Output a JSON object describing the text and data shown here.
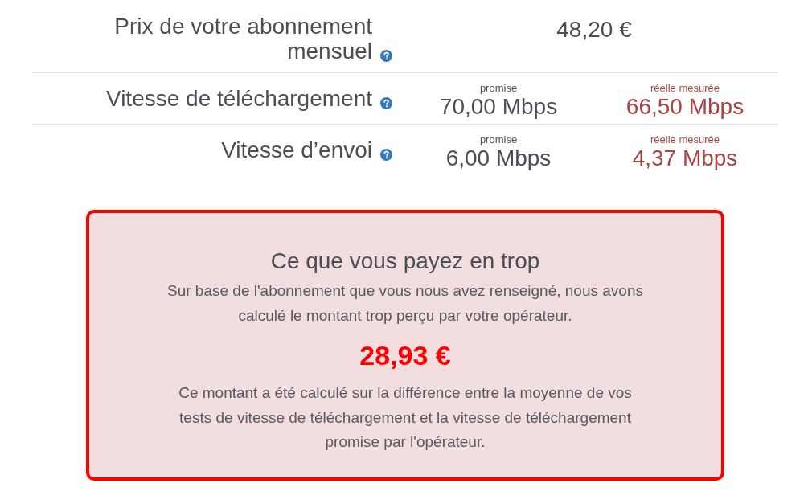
{
  "rows": [
    {
      "kind": "single",
      "label": "Prix de votre abonnement mensuel",
      "value": "48,20 €"
    },
    {
      "kind": "compare",
      "label": "Vitesse de téléchargement",
      "promised": {
        "caption": "promise",
        "value": "70,00 Mbps"
      },
      "measured": {
        "caption": "réelle mesurée",
        "value": "66,50 Mbps"
      }
    },
    {
      "kind": "compare",
      "label": "Vitesse d’envoi",
      "promised": {
        "caption": "promise",
        "value": "6,00 Mbps"
      },
      "measured": {
        "caption": "réelle mesurée",
        "value": "4,37 Mbps"
      }
    }
  ],
  "overpay_box": {
    "title": "Ce que vous payez en trop",
    "intro": "Sur base de l'abonnement que vous nous avez renseigné, nous avons calculé le montant trop perçu par votre opérateur.",
    "amount": "28,93 €",
    "explanation": "Ce montant a été calculé sur la différence entre la moyenne de vos tests de vitesse de téléchargement et la vitesse de téléchargement promise par l'opérateur."
  }
}
